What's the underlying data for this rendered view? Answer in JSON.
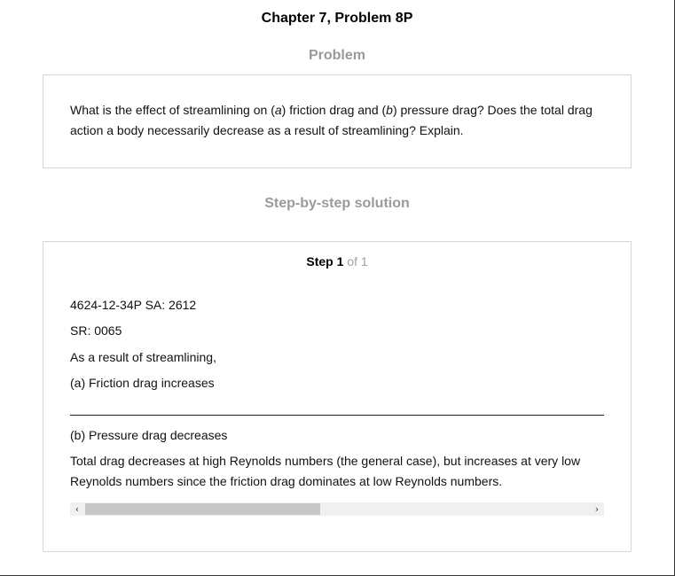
{
  "header": {
    "chapter_title": "Chapter 7, Problem 8P"
  },
  "problem": {
    "heading": "Problem",
    "text_parts": {
      "p1": "What is the effect of streamlining on (",
      "a": "a",
      "p2": ") friction drag and (",
      "b": "b",
      "p3": ") pressure drag? Does the total drag action a body necessarily decrease as a result of streamlining? Explain."
    }
  },
  "solution": {
    "heading": "Step-by-step solution",
    "step_label": "Step",
    "step_number": "1",
    "step_of": "of 1",
    "lines": [
      "4624-12-34P SA: 2612",
      "SR: 0065",
      "As a result of streamlining,",
      "(a) Friction drag increases",
      "(b) Pressure drag decreases"
    ],
    "total_text": "Total drag decreases at high Reynolds numbers (the general case), but increases at very low Reynolds numbers since the friction drag dominates at low Reynolds numbers."
  },
  "scrollbar": {
    "left_arrow": "‹",
    "right_arrow": "›",
    "left_icon": "chevron-left-icon",
    "right_icon": "chevron-right-icon"
  }
}
